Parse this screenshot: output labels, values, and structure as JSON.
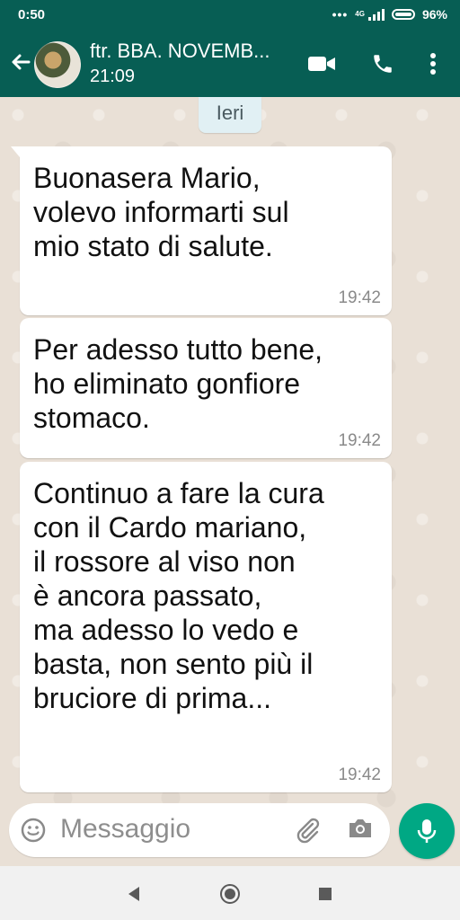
{
  "status_bar": {
    "time": "0:50",
    "network": "4G",
    "battery": "96%"
  },
  "header": {
    "chat_name": "ftr. BBA. NOVEMB...",
    "subtitle": "21:09"
  },
  "date_separator": "Ieri",
  "messages": [
    {
      "text": "Buonasera Mario,\nvolevo informarti sul\nmio stato di salute.",
      "time": "19:42"
    },
    {
      "text": "Per adesso tutto bene,\nho eliminato gonfiore\nstomaco.",
      "time": "19:42"
    },
    {
      "text": "Continuo a fare la cura\ncon il Cardo mariano,\nil rossore al viso non\nè ancora passato,\nma adesso lo vedo e\nbasta, non sento più il\nbruciore di prima...",
      "time": "19:42"
    }
  ],
  "composer": {
    "placeholder": "Messaggio"
  },
  "colors": {
    "header": "#075e54",
    "accent": "#00a884",
    "bubble": "#ffffff"
  }
}
